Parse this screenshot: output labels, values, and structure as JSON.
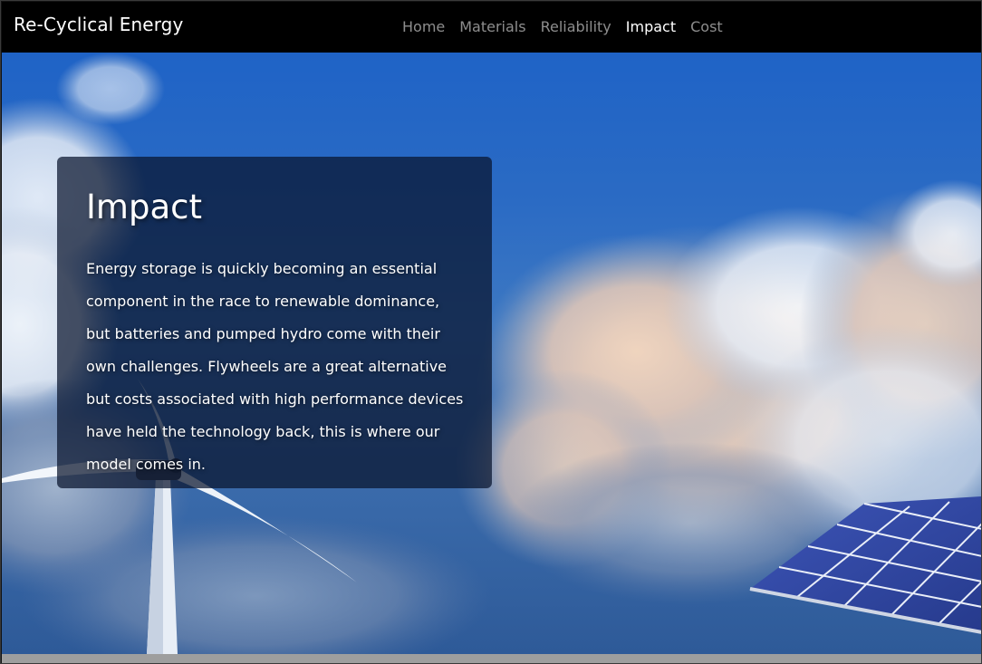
{
  "navbar": {
    "brand": "Re-Cyclical Energy",
    "links": [
      {
        "label": "Home",
        "active": false
      },
      {
        "label": "Materials",
        "active": false
      },
      {
        "label": "Reliability",
        "active": false
      },
      {
        "label": "Impact",
        "active": true
      },
      {
        "label": "Cost",
        "active": false
      }
    ]
  },
  "hero": {
    "title": "Impact",
    "body": "Energy storage is quickly becoming an essential component in the race to renewable dominance, but batteries and pumped hydro come with their own challenges. Flywheels are a great alternative but costs associated with high performance devices have held the technology back, this is where our model comes in.",
    "background_image": "sky-wind-turbine-solar-panel-image"
  },
  "colors": {
    "navbar_bg": "#000000",
    "nav_active": "#ffffff",
    "nav_inactive": "#8c8c8c",
    "sky": "#2b6bc4"
  }
}
